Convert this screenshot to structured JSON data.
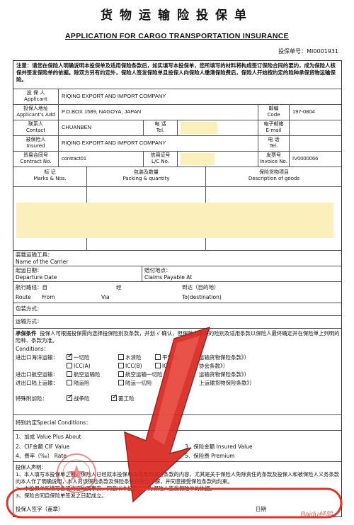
{
  "header": {
    "title_cn": "货物运输险投保单",
    "title_en": "APPLICATION FOR CARGO TRANSPORTATION INSURANCE",
    "policy_label": "投保单号：",
    "policy_no": "MI0001931"
  },
  "notice": "注意：请您在保险人明确说明本投保单及适用保险条款后，如实填写本投保单，您所填写的材料将构成签订保险合同的要约，成为保险人核保并签发保险单的依据。除双方另有约定外，保险人签发保险单且投保人向保险人缴清保险费后，保险人开始按约定的险种承保货物运输保险。",
  "applicant": {
    "label_cn": "投 保 人",
    "label_en": "Applicant",
    "value": "RIQING EXPORT AND IMPORT COMPANY"
  },
  "address": {
    "label_cn": "投保人地址",
    "label_en": "Applicant's Add",
    "value": "P.O.BOX 1589, NAGOYA, JAPAN",
    "code_cn": "邮编",
    "code_en": "Code",
    "code_value": "197-0804"
  },
  "contact": {
    "label_cn": "联系人",
    "label_en": "Contact",
    "value": "CHUANBEN",
    "tel_cn": "电 话",
    "tel_en": "Tel.",
    "email_cn": "电子邮箱",
    "email_en": "E-mail"
  },
  "insured": {
    "label_cn": "被保险人",
    "label_en": "Insured",
    "value": "RIQING EXPORT AND IMPORT COMPANY",
    "tel_cn": "电 话",
    "tel_en": "Tel."
  },
  "contract": {
    "label_cn": "贸易合同号",
    "label_en": "Contract No.",
    "value": "contract01",
    "lc_cn": "信用证号",
    "lc_en": "L/C No.",
    "invoice_cn": "发票号",
    "invoice_en": "Invoice No.",
    "invoice_value": "IV0000066"
  },
  "goods": {
    "marks_cn": "标 记",
    "marks_en": "Marks & Nos.",
    "packing_cn": "包装及数量",
    "packing_en": "Packing & quantity",
    "desc_cn": "保险货物项目",
    "desc_en": "Description of goods"
  },
  "carrier": {
    "label_cn": "装载运输工具：",
    "label_en": "Name of the Carrier"
  },
  "departure": {
    "label_cn": "起运日期：",
    "label_en": "Departure Date",
    "claims_cn": "赔付地点：",
    "claims_en": "Claims Payable At"
  },
  "route": {
    "label_cn": "航行路线：自",
    "via_cn": "经",
    "to_cn": "到达（目的地）",
    "route_en": "Route",
    "from_en": "From",
    "via_en": "Via",
    "to_en": "To(destination)"
  },
  "packing_method": "包装方式：",
  "transport_method": "运输方式：",
  "conditions": {
    "heading_cn": "承保条件",
    "text_cn": "投保人可根据投保需向选择投保险别及条款，并划 √ 确认，但保险人承保的险别及适用条款以保险人最终确定并在保险单上列明的险种、条款为准。",
    "heading_en": "Conditions：",
    "sea_label": "进出口海洋运输：",
    "sea_all": "一切险",
    "sea_wpa": "水渍险",
    "sea_fpa": "平安险",
    "sea_clause": "运输货物保险条款》）",
    "icc_a": "ICC(A)",
    "icc_b": "ICC(B)",
    "icc_c": "ICC",
    "icc_clause": "协会条款》）",
    "air_label": "进出口航空运输：",
    "air_risk": "航空运输险",
    "air_all": "航空运输一切险",
    "air_clause": "运输货物保险条款》）",
    "land_label": "进出口陆上运输：",
    "land_risk": "陆运险",
    "land_all": "陆运一切险",
    "land_clause": "上运输货物保险条款》）",
    "special_label": "特殊附加险：",
    "war": "战争险",
    "strike": "罢工险"
  },
  "special_conditions": "特别约定Special Conditions：",
  "amounts": {
    "plus_cn": "1、加成",
    "plus_en": "Value Plus About",
    "cif_cn": "2、CIF金额",
    "cif_en": "CIF Value",
    "insured_cn": "3、保险金额",
    "insured_en": "Insured Value",
    "rate_cn": "4、费率（‰）",
    "rate_en": "Rate",
    "premium_cn": "5、保险费",
    "premium_en": "Premium"
  },
  "declaration": {
    "heading": "投保人声明：",
    "line1": "1、本人填写本投保单之前，保险人已经就本投保单及适用的保险条款的内容，尤其是关于保险人免除责任的条款及投保人和被保险人义务条款向本人作了明确说明，本人对该保险条款及保险条件已完全了解，并同意接受保险条款的约束。",
    "line2": "2、本投保单所填写各项内容均属事实，同意以本投保单作为保险人签发保险单的依据。",
    "line3": "3、保险合同自保险单签发之日起成立。",
    "sign": "投保人签字（盖章）",
    "date": "日期"
  },
  "watermark": "Baidu经验",
  "colors": {
    "highlight": "#fbefbc",
    "arrow": "#d8261f",
    "circle": "#e0342c"
  }
}
